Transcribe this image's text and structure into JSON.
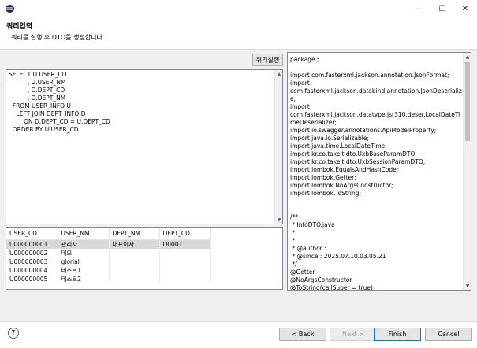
{
  "window": {
    "minimize_glyph": "—",
    "maximize_glyph": "☐",
    "close_glyph": "✕"
  },
  "header": {
    "title": "쿼리입력",
    "description": "쿼리를 실행 후 DTO를 생성합니다"
  },
  "toolbar": {
    "run_label": "쿼리실행"
  },
  "sql": {
    "text": "SELECT U.USER_CD\n          , U.USER_NM\n          , D.DEPT_CD\n          , D.DEPT_NM\n  FROM USER_INFO U\n    LEFT JOIN DEPT_INFO D\n        ON D.DEPT_CD = U.DEPT_CD\n  ORDER BY U.USER_CD"
  },
  "grid": {
    "columns": [
      "USER_CD",
      "USER_NM",
      "DEPT_NM",
      "DEPT_CD"
    ],
    "rows": [
      [
        "U000000001",
        "관리자",
        "대표이사",
        "D0001"
      ],
      [
        "U000000002",
        "데모",
        "",
        ""
      ],
      [
        "U000000003",
        "glorial",
        "",
        ""
      ],
      [
        "U000000004",
        "테스트1",
        "",
        ""
      ],
      [
        "U000000005",
        "테스트2",
        "",
        ""
      ]
    ]
  },
  "code": {
    "text": "package ;\n\nimport com.fasterxml.jackson.annotation.JsonFormat;\nimport\ncom.fasterxml.jackson.databind.annotation.JsonDeserialize;\nimport\ncom.fasterxml.jackson.datatype.jsr310.deser.LocalDateTimeDeserializer;\nimport io.swagger.annotations.ApiModelProperty;\nimport java.io.Serializable;\nimport java.time.LocalDateTime;\nimport kr.co.takeit.dto.UxbBaseParamDTO;\nimport kr.co.takeit.dto.UxbSessionParamDTO;\nimport lombok.EqualsAndHashCode;\nimport lombok.Getter;\nimport lombok.NoArgsConstructor;\nimport lombok.ToString;\n\n\n/**\n * InfoDTO.java\n *\n *\n * @author :\n * @since : 2025.07.10.03.05.21\n */\n@Getter\n@NoArgsConstructor\n@ToString(callSuper = true)\n@EqualsAndHashCode(callSuper = false)\npublic class InfoDTO extends UxbBaseParamDTO implements Serializable {"
  },
  "footer": {
    "help_glyph": "?",
    "back_label": "< Back",
    "next_label": "Next >",
    "finish_label": "Finish",
    "cancel_label": "Cancel"
  }
}
